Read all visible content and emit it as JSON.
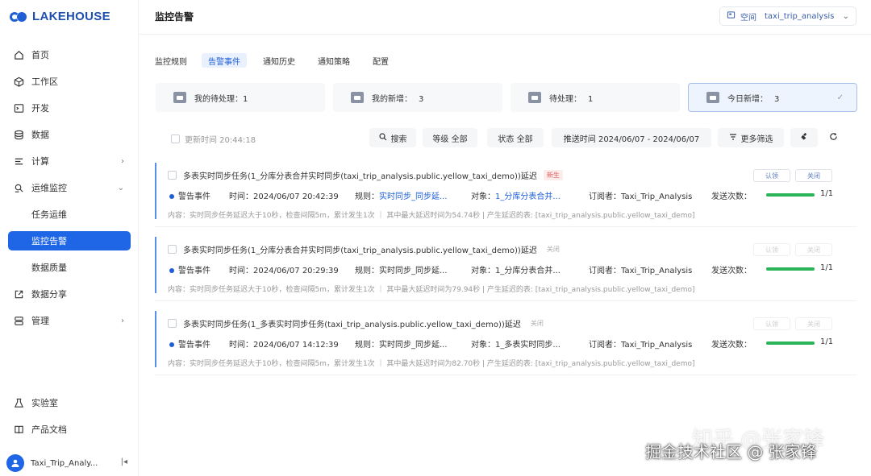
{
  "logo": {
    "text": "LAKEHOUSE"
  },
  "sidebar": {
    "items": [
      {
        "label": "首页"
      },
      {
        "label": "工作区"
      },
      {
        "label": "开发"
      },
      {
        "label": "数据"
      },
      {
        "label": "计算"
      },
      {
        "label": "运维监控"
      },
      {
        "label": "任务运维"
      },
      {
        "label": "监控告警"
      },
      {
        "label": "数据质量"
      },
      {
        "label": "数据分享"
      },
      {
        "label": "管理"
      },
      {
        "label": "实验室"
      },
      {
        "label": "产品文档"
      }
    ],
    "user": "Taxi_Trip_Analy..."
  },
  "header": {
    "title": "监控告警",
    "space_label": "空间",
    "space_value": "taxi_trip_analysis"
  },
  "tabs": [
    {
      "label": "监控规则"
    },
    {
      "label": "告警事件"
    },
    {
      "label": "通知历史"
    },
    {
      "label": "通知策略"
    },
    {
      "label": "配置"
    }
  ],
  "stats": [
    {
      "label": "我的待处理：",
      "value": "1"
    },
    {
      "label": "我的新增：",
      "value": "3"
    },
    {
      "label": "待处理：",
      "value": "1"
    },
    {
      "label": "今日新增：",
      "value": "3"
    }
  ],
  "filters": {
    "update_time": "更新时间 20:44:18",
    "search": "搜索",
    "level": "等级 全部",
    "status": "状态 全部",
    "push_time": "推送时间 2024/06/07 - 2024/06/07",
    "more": "更多筛选"
  },
  "alerts": [
    {
      "title": "多表实时同步任务(1_分库分表合并实时同步(taxi_trip_analysis.public.yellow_taxi_demo))延迟",
      "badge": "新生",
      "type": "警告事件",
      "time": "时间：2024/06/07 20:42:39",
      "rule_label": "规则：",
      "rule": "实时同步_同步延...",
      "object_label": "对象：",
      "object": "1_分库分表合并...",
      "subscriber": "订阅者：Taxi_Trip_Analysis",
      "send_label": "发送次数：",
      "send_count": "1/1",
      "send_progress": 1,
      "content": "内容：实时同步任务延迟大于10秒，检查间隔5m，累计发生1次 ｜ 其中最大延迟时间为54.74秒 | 产生延迟的表: [taxi_trip_analysis.public.yellow_taxi_demo]",
      "btn1": "认领",
      "btn2": "关闭"
    },
    {
      "title": "多表实时同步任务(1_分库分表合并实时同步(taxi_trip_analysis.public.yellow_taxi_demo))延迟",
      "badge": "关闭",
      "type": "警告事件",
      "time": "时间：2024/06/07 20:29:39",
      "rule_label": "规则：",
      "rule": "实时同步_同步延...",
      "object_label": "对象：",
      "object": "1_分库分表合并...",
      "subscriber": "订阅者：Taxi_Trip_Analysis",
      "send_label": "发送次数：",
      "send_count": "1/1",
      "send_progress": 1,
      "content": "内容：实时同步任务延迟大于10秒，检查间隔5m，累计发生1次 ｜ 其中最大延迟时间为79.94秒 | 产生延迟的表: [taxi_trip_analysis.public.yellow_taxi_demo]",
      "btn1": "认领",
      "btn2": "关闭"
    },
    {
      "title": "多表实时同步任务(1_多表实时同步任务(taxi_trip_analysis.public.yellow_taxi_demo))延迟",
      "badge": "关闭",
      "type": "警告事件",
      "time": "时间：2024/06/07 14:12:39",
      "rule_label": "规则：",
      "rule": "实时同步_同步延...",
      "object_label": "对象：",
      "object": "1_多表实时同步...",
      "subscriber": "订阅者：Taxi_Trip_Analysis",
      "send_label": "发送次数：",
      "send_count": "1/1",
      "send_progress": 1,
      "content": "内容：实时同步任务延迟大于10秒，检查间隔5m，累计发生1次 ｜ 其中最大延迟时间为82.70秒 | 产生延迟的表: [taxi_trip_analysis.public.yellow_taxi_demo]",
      "btn1": "认领",
      "btn2": "关闭"
    }
  ],
  "watermark": {
    "line1": "知乎 @张家锋",
    "line2": "掘金技术社区 @ 张家锋"
  }
}
